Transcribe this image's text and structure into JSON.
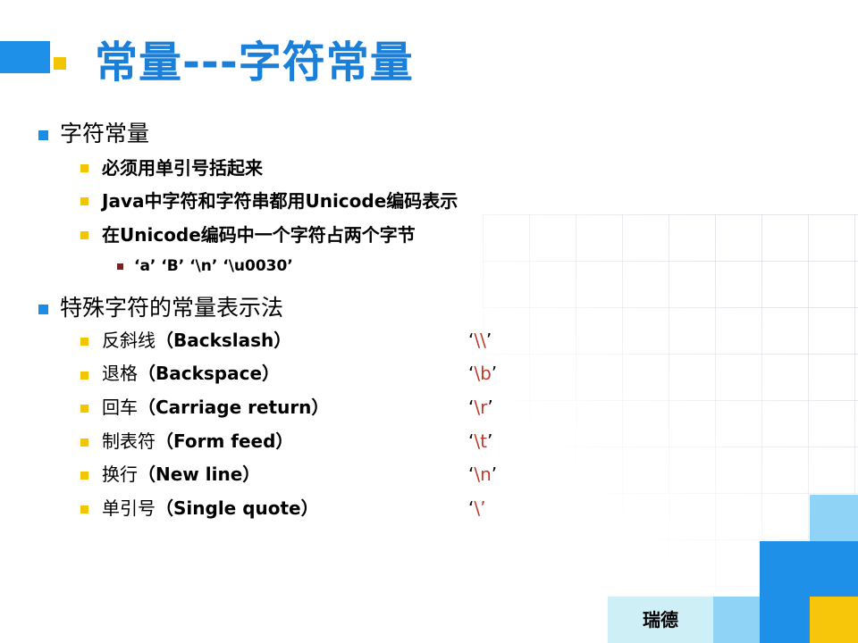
{
  "title": "常量---字符常量",
  "section1": {
    "heading": "字符常量",
    "items": [
      "必须用单引号括起来",
      "Java中字符和字符串都用Unicode编码表示",
      "在Unicode编码中一个字符占两个字节"
    ],
    "example": "‘a’ ‘B’ ‘\\n’    ‘\\u0030’"
  },
  "section2": {
    "heading": "特殊字符的常量表示法",
    "rows": [
      {
        "cn": "反斜线",
        "en": "（Backslash）",
        "code": "\\\\"
      },
      {
        "cn": "退格",
        "en": "（Backspace）",
        "code": "\\b"
      },
      {
        "cn": "回车",
        "en": "（Carriage return）",
        "code": "\\r"
      },
      {
        "cn": "制表符",
        "en": "（Form feed）",
        "code": "\\t"
      },
      {
        "cn": "换行",
        "en": "（New line）",
        "code": "\\n"
      },
      {
        "cn": "单引号",
        "en": "（Single quote）",
        "code": "\\’"
      }
    ]
  },
  "footer": {
    "label": "瑞德"
  },
  "colors": {
    "title": "#1a7fd8",
    "accent_blue": "#1e90e8",
    "accent_yellow": "#f2c500",
    "code_red": "#c0392b"
  }
}
